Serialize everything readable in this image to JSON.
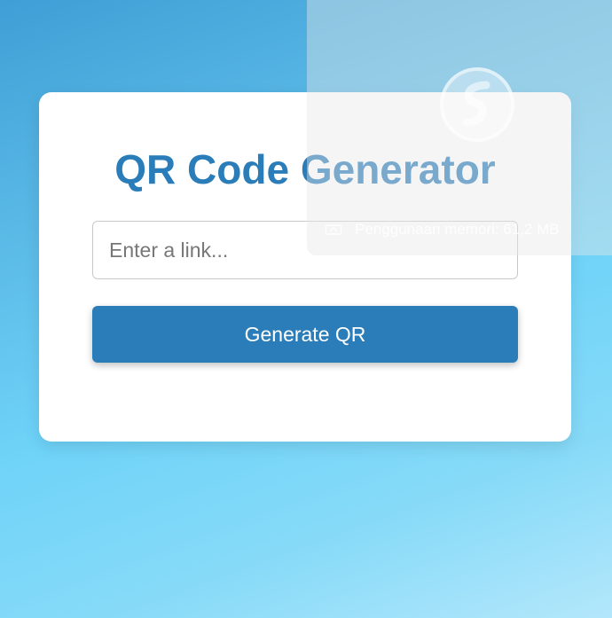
{
  "app": {
    "title": "QR Code Generator"
  },
  "form": {
    "link_placeholder": "Enter a link...",
    "link_value": "",
    "generate_label": "Generate QR"
  },
  "overlay": {
    "memory_text": "Penggunaan memori: 61,2 MB",
    "logo_icon": "circular-logo-icon",
    "memory_icon": "memory-chip-icon"
  },
  "colors": {
    "accent": "#2a7db8",
    "card_background": "#ffffff"
  }
}
